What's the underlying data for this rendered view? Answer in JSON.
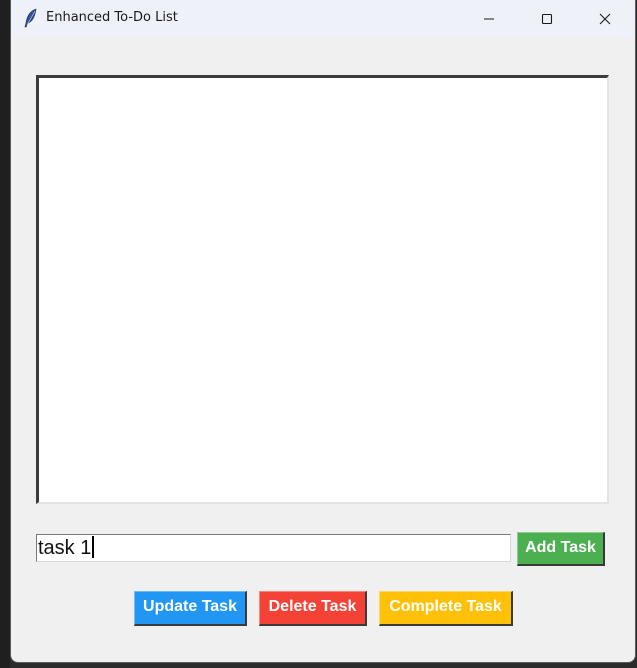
{
  "window": {
    "title": "Enhanced To-Do List",
    "icon": "feather-icon",
    "controls": [
      "minimize-icon",
      "maximize-icon",
      "close-icon"
    ]
  },
  "task_list": {
    "items": []
  },
  "entry": {
    "value": "task 1"
  },
  "buttons": {
    "add": "Add Task",
    "update": "Update Task",
    "delete": "Delete Task",
    "complete": "Complete Task"
  },
  "colors": {
    "add": "#4caf50",
    "update": "#2196f3",
    "delete": "#f44336",
    "complete": "#ffc107"
  }
}
